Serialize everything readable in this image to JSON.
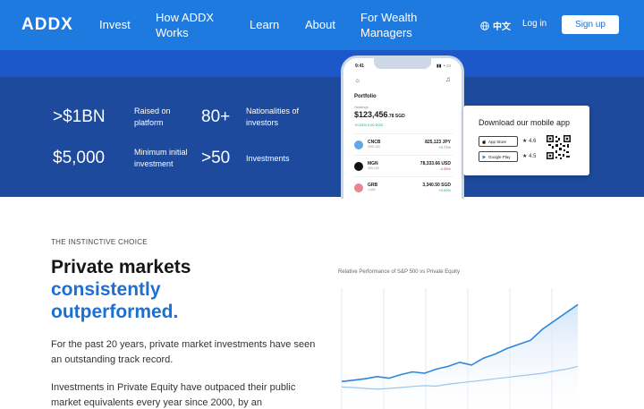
{
  "header": {
    "logo": "ADDX",
    "nav": [
      "Invest",
      "How ADDX Works",
      "Learn",
      "About",
      "For Wealth Managers"
    ],
    "language": "中文",
    "login": "Log in",
    "signup": "Sign up"
  },
  "stats": [
    {
      "value": ">$1BN",
      "label": "Raised on platform"
    },
    {
      "value": "80+",
      "label": "Nationalities of investors"
    },
    {
      "value": "$5,000",
      "label": "Minimum initial investment"
    },
    {
      "value": ">50",
      "label": "Investments"
    }
  ],
  "phone": {
    "time": "9:41",
    "title": "Portfolio",
    "holdings_label": "Holdings",
    "balance": "$123,456",
    "balance_cents": ".78 SGD",
    "change": "+0.03% 0.00 SGD",
    "rows": [
      {
        "ticker": "CNCB",
        "sub": "SBD,100",
        "amount": "825,123 JPY",
        "pct": "+0.71%",
        "pct_color": "#19a35b",
        "icon_color": "#5fa8e8"
      },
      {
        "ticker": "MGN",
        "sub": "350,150",
        "amount": "78,333.66 USD",
        "pct": "-4.35%",
        "pct_color": "#d9363e",
        "icon_color": "#111111"
      },
      {
        "ticker": "GRB",
        "sub": "1,650",
        "amount": "3,340.50 SGD",
        "pct": "+0.00%",
        "pct_color": "#19a35b",
        "icon_color": "#e8868c"
      }
    ]
  },
  "app_card": {
    "title": "Download our mobile app",
    "app_store": "App Store",
    "app_store_rating": "4.6",
    "google_play": "Google Play",
    "google_play_rating": "4.5"
  },
  "section": {
    "eyebrow": "THE INSTINCTIVE CHOICE",
    "headline_1": "Private markets",
    "headline_2": "consistently",
    "headline_3": "outperformed.",
    "para_1": "For the past 20 years, private market investments have seen an outstanding track record.",
    "para_2": "Investments in Private Equity have outpaced their public market equivalents every year since 2000, by an"
  },
  "chart_data": {
    "type": "area",
    "title": "Relative Performance of S&P 500 vs Private Equity",
    "x": [
      0,
      1,
      2,
      3,
      4,
      5,
      6,
      7,
      8,
      9,
      10,
      11,
      12,
      13,
      14,
      15,
      16,
      17,
      18,
      19,
      20
    ],
    "series": [
      {
        "values": [
          1.0,
          1.05,
          1.1,
          1.18,
          1.12,
          1.25,
          1.35,
          1.3,
          1.45,
          1.55,
          1.7,
          1.6,
          1.85,
          2.0,
          2.2,
          2.35,
          2.5,
          2.9,
          3.2,
          3.5,
          3.8
        ],
        "color": "#2f86df"
      },
      {
        "values": [
          0.8,
          0.78,
          0.75,
          0.72,
          0.75,
          0.78,
          0.82,
          0.85,
          0.83,
          0.9,
          0.95,
          1.0,
          1.05,
          1.1,
          1.15,
          1.2,
          1.25,
          1.3,
          1.38,
          1.45,
          1.55
        ],
        "color": "#9ec4ee"
      }
    ],
    "ylim": [
      0,
      4.2
    ],
    "grid": "vertical"
  }
}
